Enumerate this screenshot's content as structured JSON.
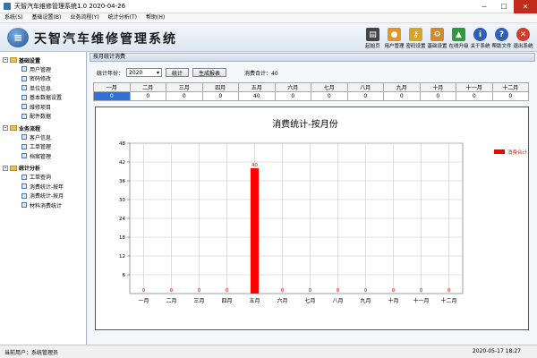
{
  "window": {
    "title": "天智汽车维修管理系统1.0 2020-04-26",
    "controls": {
      "minimize": "─",
      "maximize": "☐",
      "close": "✕"
    }
  },
  "menu": [
    "系统(S)",
    "基础设置(B)",
    "业务流程(Y)",
    "统计分析(T)",
    "帮助(H)"
  ],
  "banner": {
    "logo_glyph": "≡",
    "system_name": "天智汽车维修管理系统"
  },
  "toolbar": [
    {
      "label": "起始页",
      "icon": "start-page-icon",
      "glyph": "▤",
      "color": "#444444"
    },
    {
      "label": "用户管理",
      "icon": "users-icon",
      "glyph": "●",
      "color": "#e0942a"
    },
    {
      "label": "密码设置",
      "icon": "keys-icon",
      "glyph": "⚷",
      "color": "#d6a52a"
    },
    {
      "label": "基础设置",
      "icon": "tools-icon",
      "glyph": "⚙",
      "color": "#d08a2a"
    },
    {
      "label": "在线升级",
      "icon": "upgrade-arrow-icon",
      "glyph": "▲",
      "color": "#2e9b3a"
    },
    {
      "label": "关于系统",
      "icon": "info-icon",
      "glyph": "i",
      "color": "#2c5fb8"
    },
    {
      "label": "帮助文件",
      "icon": "help-icon",
      "glyph": "?",
      "color": "#2c5fb8"
    },
    {
      "label": "退出系统",
      "icon": "exit-icon",
      "glyph": "✕",
      "color": "#d23a2a"
    }
  ],
  "sidebar": {
    "groups": [
      {
        "label": "基础设置",
        "expander": "-",
        "items": [
          "用户管理",
          "密码修改",
          "单位信息",
          "基本数据设置",
          "维修项目",
          "配件数据"
        ]
      },
      {
        "label": "业务流程",
        "expander": "-",
        "items": [
          "客户信息",
          "工单管理",
          "档案管理"
        ]
      },
      {
        "label": "统计分析",
        "expander": "-",
        "items": [
          "工单查询",
          "消费统计-按年",
          "消费统计-按月",
          "材料消费统计"
        ]
      }
    ]
  },
  "main": {
    "panel_title": "按月统计消费",
    "filter": {
      "year_label": "统计年份：",
      "year_value": "2020",
      "dropdown_glyph": "▾",
      "stat_button": "统计",
      "report_button": "生成报表",
      "total_label": "消费合计：40"
    },
    "month_table": {
      "headers": [
        "一月",
        "二月",
        "三月",
        "四月",
        "五月",
        "六月",
        "七月",
        "八月",
        "九月",
        "十月",
        "十一月",
        "十二月"
      ],
      "values": [
        "0",
        "0",
        "0",
        "0",
        "40",
        "0",
        "0",
        "0",
        "0",
        "0",
        "0",
        "0"
      ]
    }
  },
  "status": {
    "current_user": "当前用户：系统管理员",
    "datetime": "2020-05-17 18:27"
  },
  "colors": {
    "bar": "#ff0000",
    "selected_cell": "#2f73d8"
  },
  "chart_data": {
    "type": "bar",
    "title": "消费统计-按月份",
    "categories": [
      "一月",
      "二月",
      "三月",
      "四月",
      "五月",
      "六月",
      "七月",
      "八月",
      "九月",
      "十月",
      "十一月",
      "十二月"
    ],
    "series": [
      {
        "name": "消费合计",
        "values": [
          0,
          0,
          0,
          0,
          40,
          0,
          0,
          0,
          0,
          0,
          0,
          0
        ]
      }
    ],
    "data_labels": [
      "0",
      "0",
      "0",
      "0",
      "40",
      "0",
      "0",
      "0",
      "0",
      "0",
      "0",
      "0"
    ],
    "yticks": [
      6,
      12,
      18,
      24,
      30,
      36,
      42,
      48
    ],
    "ylim": [
      0,
      48
    ],
    "xlabel": "",
    "ylabel": "",
    "grid": true,
    "legend": "right"
  }
}
